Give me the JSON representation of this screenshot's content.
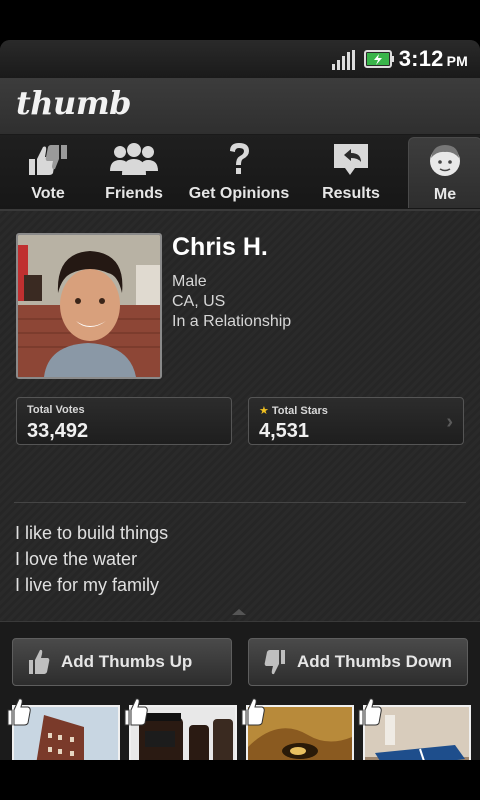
{
  "status": {
    "time": "3:12",
    "ampm": "PM"
  },
  "app": {
    "logo": "thumb"
  },
  "tabs": [
    {
      "label": "Vote",
      "icon": "thumbs-vote-icon"
    },
    {
      "label": "Friends",
      "icon": "friends-icon"
    },
    {
      "label": "Get Opinions",
      "icon": "question-mark-icon"
    },
    {
      "label": "Results",
      "icon": "results-reply-icon"
    },
    {
      "label": "Me",
      "icon": "me-face-icon",
      "active": true
    }
  ],
  "profile": {
    "name": "Chris H.",
    "gender": "Male",
    "location": "CA, US",
    "relationship": "In a Relationship",
    "stats": {
      "total_votes_label": "Total Votes",
      "total_votes": "33,492",
      "total_stars_label": "Total Stars",
      "total_stars": "4,531"
    },
    "bio": [
      "I like to build things",
      "I love the water",
      "I live for my family"
    ]
  },
  "actions": {
    "thumbs_up": "Add Thumbs Up",
    "thumbs_down": "Add Thumbs Down"
  },
  "thumbnails": [
    {
      "subject": "brick building"
    },
    {
      "subject": "coffee jars"
    },
    {
      "subject": "ocean wave"
    },
    {
      "subject": "ping pong table"
    }
  ],
  "colors": {
    "star": "#f0c020",
    "background": "#262626"
  }
}
